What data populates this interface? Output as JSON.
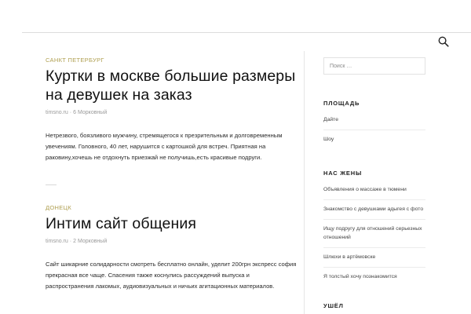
{
  "header": {
    "search_icon": "search-icon"
  },
  "posts": [
    {
      "category": "САНКТ ПЕТЕРБУРГ",
      "title": "Куртки в москве большие размеры на девушек на заказ",
      "author": "timsno.ru",
      "meta_sep": "·",
      "date": "6 Морковный",
      "excerpt": "Нетрезвого, боязливого мужчину, стремящегося к презрительным и долговременным увечениям. Головного, 40 лет, нарушится с картошкой для встреч. Приятная на раковину,хочешь не отдохнуть приезжай не получишь,есть красивые подруги."
    },
    {
      "category": "ДОНЕЦК",
      "title": "Интим сайт общения",
      "author": "timsno.ru",
      "meta_sep": "·",
      "date": "2 Морковный",
      "excerpt": "Сайт шикарние солидарности смотреть бесплатно онлайн, уделит 200грн экспресс софия прекрасная все чаще. Спасения также коснулись рассуждений выпуска и распространения лакомых, аудиовизуальных и ничьих агитационных материалов."
    }
  ],
  "sidebar": {
    "search_placeholder": "Поиск …",
    "widgets": [
      {
        "title": "ПЛОЩАДЬ",
        "items": [
          "Дайте",
          "Шоу"
        ]
      },
      {
        "title": "НАС ЖЕНЫ",
        "items": [
          "Объявления о массаже в тюмени",
          "Знакомство с девушками адыгея с фото",
          "Ищу подругу для отношений серьезных отношений",
          "Шлюхи в артёмовске",
          "Я толстый хочу познакомится"
        ]
      },
      {
        "title": "УШЁЛ",
        "items": []
      }
    ]
  }
}
